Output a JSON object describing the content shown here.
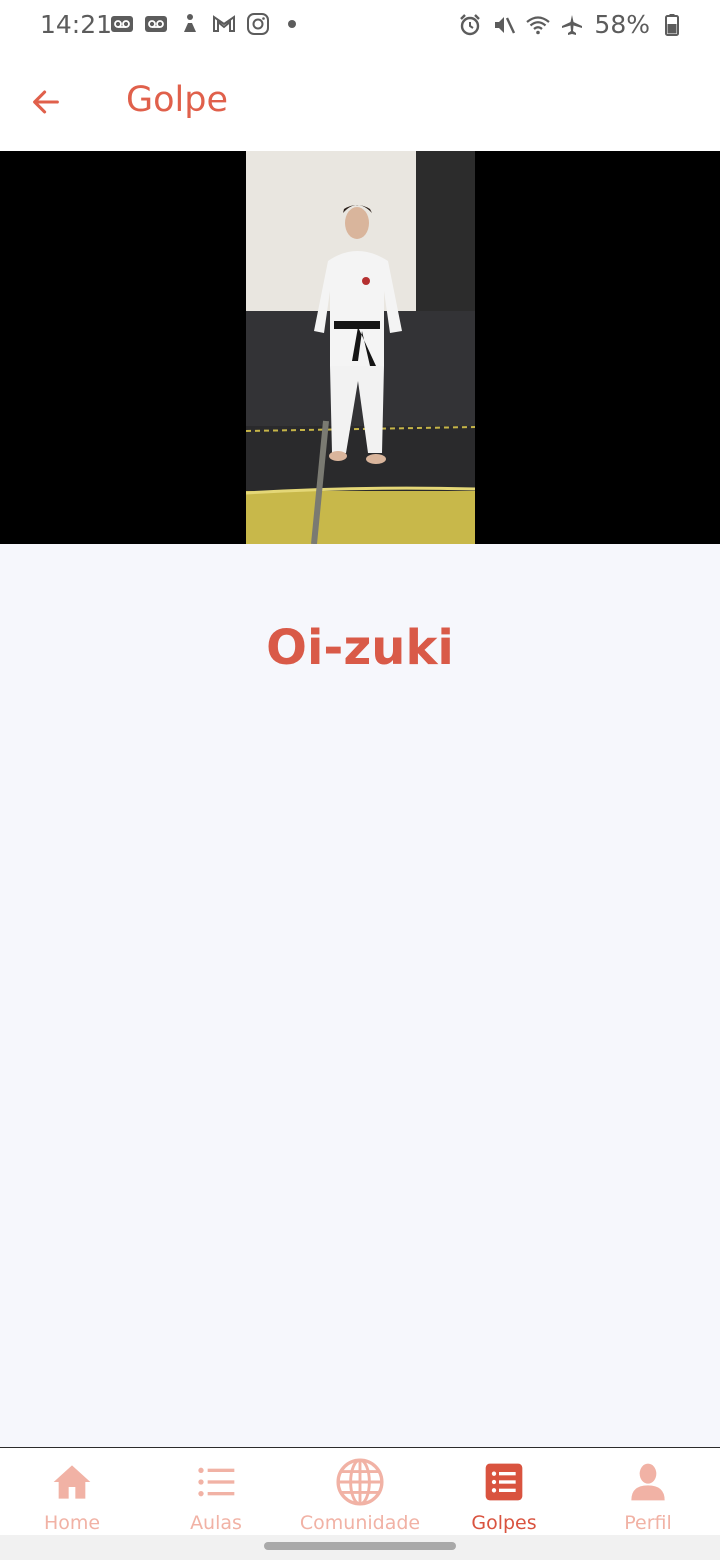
{
  "status_bar": {
    "time": "14:21",
    "battery": "58%",
    "left_icons": [
      "voicemail-icon",
      "voicemail-icon",
      "fitness-icon",
      "gmail-icon",
      "instagram-icon",
      "dot-icon"
    ],
    "right_icons": [
      "alarm-icon",
      "mute-icon",
      "wifi-icon",
      "airplane-icon",
      "battery-icon"
    ]
  },
  "app_bar": {
    "title": "Golpe",
    "back_icon": "arrow-left-icon"
  },
  "video": {
    "description_icon": "video-player"
  },
  "content": {
    "title": "Oi-zuki"
  },
  "bottom_nav": {
    "items": [
      {
        "label": "Home",
        "icon": "home-icon",
        "active": false
      },
      {
        "label": "Aulas",
        "icon": "list-icon",
        "active": false
      },
      {
        "label": "Comunidade",
        "icon": "globe-icon",
        "active": false
      },
      {
        "label": "Golpes",
        "icon": "list-box-icon",
        "active": true
      },
      {
        "label": "Perfil",
        "icon": "person-icon",
        "active": false
      }
    ]
  },
  "colors": {
    "accent": "#e0604b",
    "accent_dark": "#d9533f",
    "inactive": "#f1b2a5",
    "background": "#f6f7fc"
  }
}
